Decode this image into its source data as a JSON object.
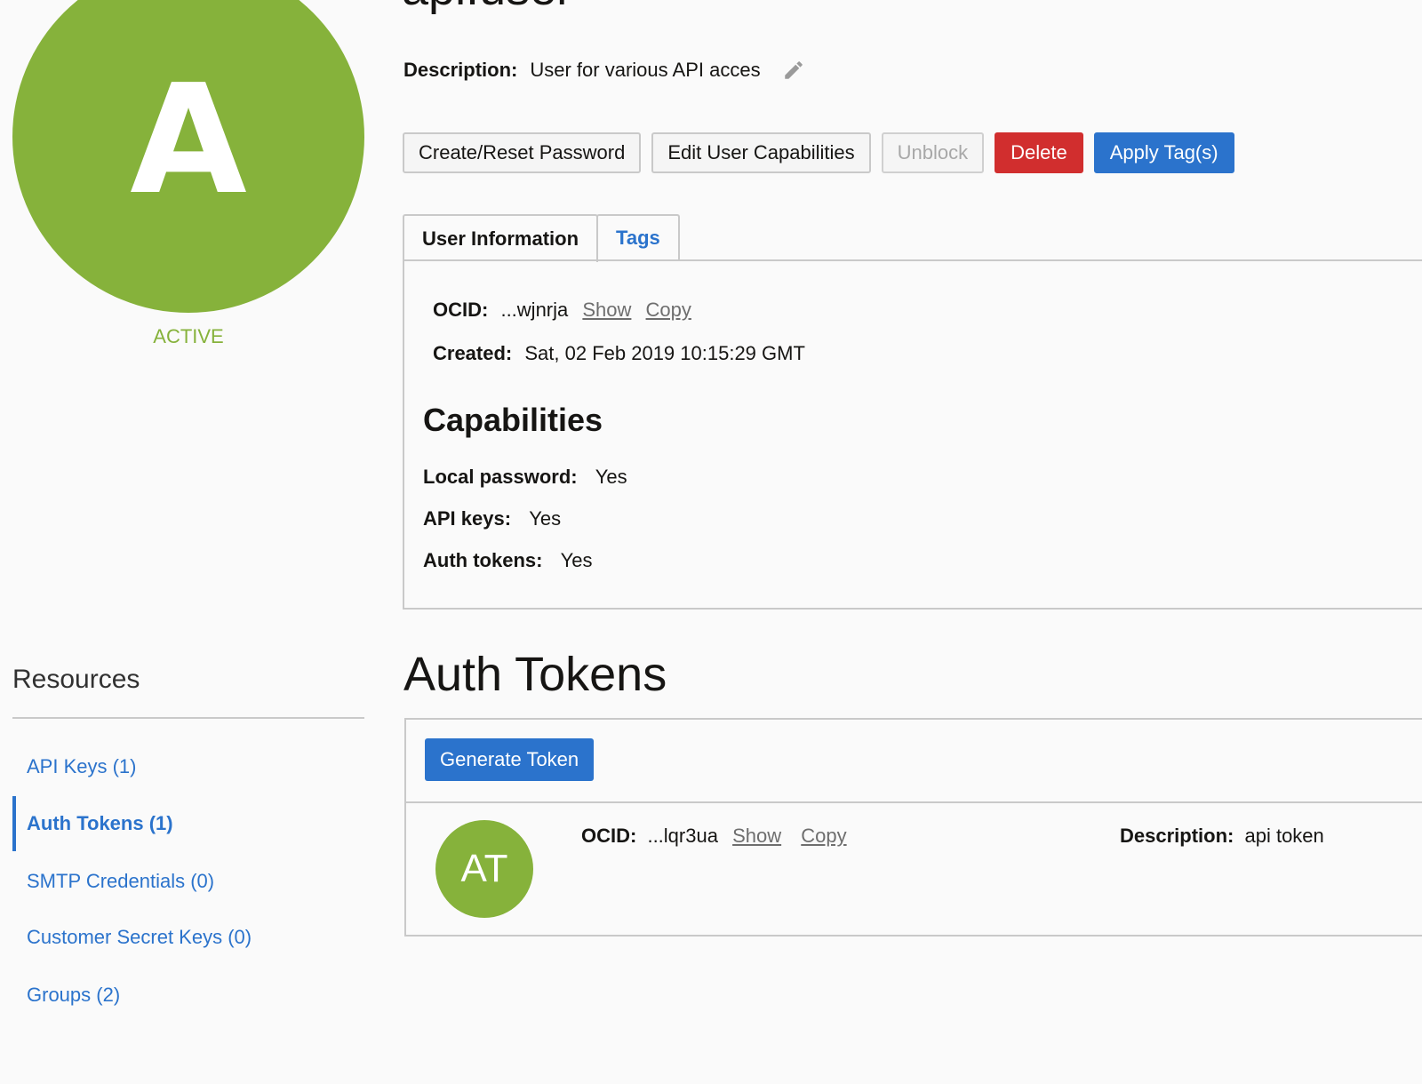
{
  "user": {
    "title_partial": "api.user",
    "avatar_letter": "A",
    "status": "ACTIVE",
    "description_label": "Description:",
    "description_value": "User for various API acces"
  },
  "actions": {
    "create_reset_password": "Create/Reset Password",
    "edit_user_capabilities": "Edit User Capabilities",
    "unblock": "Unblock",
    "delete": "Delete",
    "apply_tags": "Apply Tag(s)"
  },
  "tabs": [
    {
      "label": "User Information",
      "active": true
    },
    {
      "label": "Tags",
      "active": false
    }
  ],
  "user_information": {
    "ocid_label": "OCID:",
    "ocid_value": "...wjnrja",
    "show_link": "Show",
    "copy_link": "Copy",
    "created_label": "Created:",
    "created_value": "Sat, 02 Feb 2019 10:15:29 GMT"
  },
  "capabilities": {
    "title": "Capabilities",
    "items": [
      {
        "label": "Local password:",
        "value": "Yes"
      },
      {
        "label": "API keys:",
        "value": "Yes"
      },
      {
        "label": "Auth tokens:",
        "value": "Yes"
      }
    ]
  },
  "resources": {
    "title": "Resources",
    "items": [
      {
        "label": "API Keys (1)",
        "active": false
      },
      {
        "label": "Auth Tokens (1)",
        "active": true
      },
      {
        "label": "SMTP Credentials (0)",
        "active": false
      },
      {
        "label": "Customer Secret Keys (0)",
        "active": false
      },
      {
        "label": "Groups (2)",
        "active": false
      }
    ]
  },
  "auth_tokens": {
    "title": "Auth Tokens",
    "generate_button": "Generate Token",
    "token": {
      "avatar_initials": "AT",
      "ocid_label": "OCID:",
      "ocid_value": "...lqr3ua",
      "show_link": "Show",
      "copy_link": "Copy",
      "description_label": "Description:",
      "description_value": "api token"
    }
  },
  "colors": {
    "accent_green": "#86b23b",
    "link_blue": "#2b73cc",
    "danger_red": "#d12e2e"
  }
}
